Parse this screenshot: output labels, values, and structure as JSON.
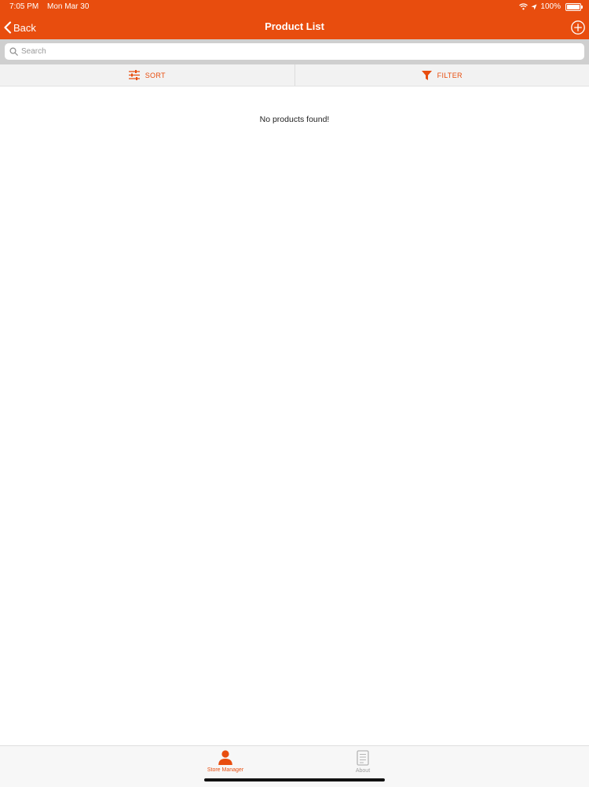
{
  "status_bar": {
    "time": "7:05 PM",
    "date": "Mon Mar 30",
    "battery_text": "100%",
    "battery_level": 1.0
  },
  "navigation": {
    "back_label": "Back",
    "title": "Product List",
    "add_icon": "plus-circle-icon"
  },
  "search": {
    "placeholder": "Search",
    "value": ""
  },
  "actions": {
    "sort_label": "SORT",
    "filter_label": "FILTER"
  },
  "content": {
    "empty_message": "No products found!"
  },
  "tab_bar": {
    "tabs": [
      {
        "label": "Store Manager",
        "icon": "person-icon",
        "active": true
      },
      {
        "label": "About",
        "icon": "document-icon",
        "active": false
      }
    ]
  },
  "colors": {
    "accent": "#E84D0E",
    "search_bar_background": "#cfcfcf",
    "inactive_tab": "#a0a0a0"
  }
}
